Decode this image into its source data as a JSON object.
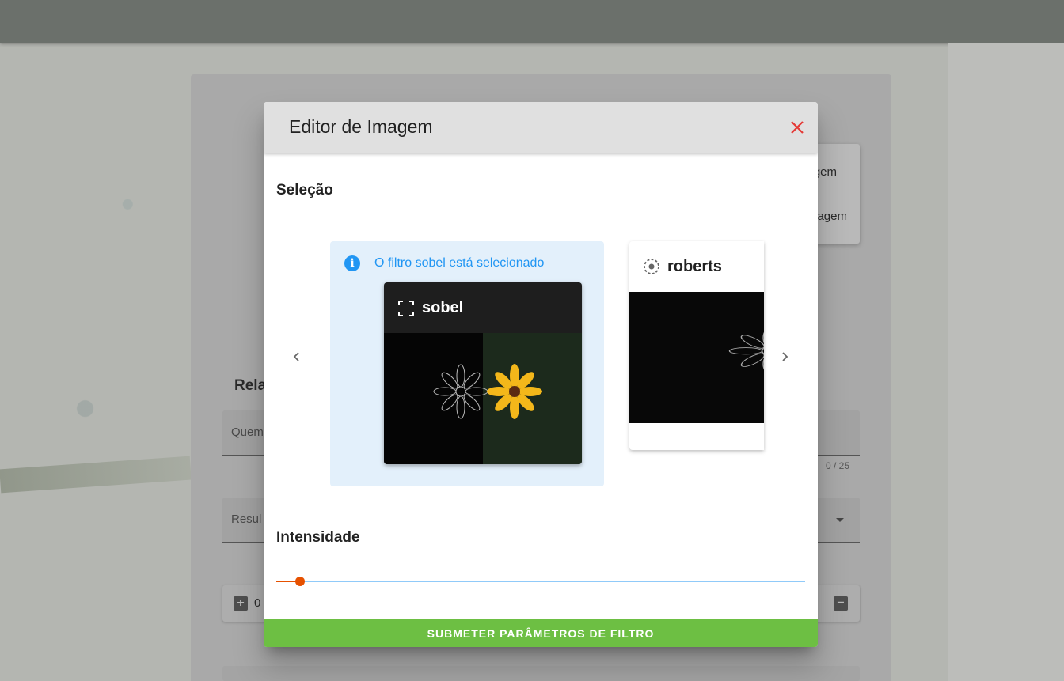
{
  "background": {
    "menu_item_1": "gem",
    "menu_item_2": "agem",
    "heading": "Rela",
    "field1_placeholder": "Quem",
    "field1_counter": "0 / 25",
    "field2_placeholder": "Resul",
    "stepper_value": "0"
  },
  "dialog": {
    "title": "Editor de Imagem",
    "selection_title": "Seleção",
    "info_text": "O filtro sobel está selecionado",
    "filters": [
      {
        "name": "sobel",
        "icon": "selection-frame-icon",
        "selected": true
      },
      {
        "name": "roberts",
        "icon": "radio-dashed-icon",
        "selected": false
      }
    ],
    "intensity_title": "Intensidade",
    "intensity_value": 0.045,
    "submit_label": "SUBMETER PARÂMETROS DE FILTRO"
  },
  "colors": {
    "accent_orange": "#e65100",
    "info_blue": "#2196f3",
    "submit_green": "#6dbf43",
    "close_red": "#e53935"
  }
}
